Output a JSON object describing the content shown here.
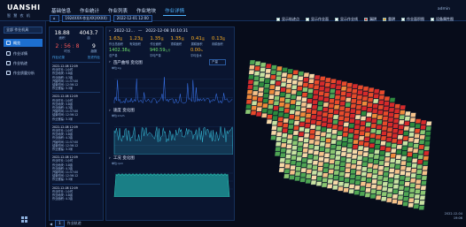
{
  "app": {
    "logo": "UANSHI",
    "logo_sub": "智 慧 农 机"
  },
  "nav": [
    {
      "label": "基础信息",
      "active": false
    },
    {
      "label": "作业统计",
      "active": false
    },
    {
      "label": "作业列表",
      "active": false
    },
    {
      "label": "作业地块",
      "active": false
    },
    {
      "label": "作业详情",
      "active": true
    }
  ],
  "user": {
    "name": "admin"
  },
  "sidebar": {
    "selector": "全部 作业机具",
    "items": [
      {
        "label": "概览",
        "active": true
      },
      {
        "label": "作业详情",
        "active": false
      },
      {
        "label": "作业轨迹",
        "active": false
      },
      {
        "label": "作业质量分析",
        "active": false
      }
    ]
  },
  "toolbar": {
    "device": "1924XXX-作业XX(XXXX)",
    "date": "2022-12-01 12:00"
  },
  "legend": [
    {
      "label": "显示轨迹点",
      "color": "#ffffff"
    },
    {
      "label": "显示作业面",
      "color": "#ffffff"
    },
    {
      "label": "显示作业线",
      "color": "#ffffff"
    },
    {
      "label": "漏耕",
      "color": "#e03a3a"
    },
    {
      "label": "重耕",
      "color": "#f0a020"
    },
    {
      "label": "作业面积图",
      "color": "#ffffff"
    },
    {
      "label": "设备属性图",
      "color": "#ffffff"
    }
  ],
  "left_panel": {
    "stats": [
      {
        "value": "18.88",
        "label": "面积",
        "red": false
      },
      {
        "value": "4043.7",
        "label": "亩",
        "red": false
      }
    ],
    "stats2": [
      {
        "value": "2 : 56 : 8",
        "label": "时长",
        "red": true
      },
      {
        "value": "9",
        "label": "趟数",
        "red": false
      }
    ],
    "tag": "作业记录",
    "tag_right": "历史作业",
    "records": [
      {
        "time": "2022-12-08 12:09",
        "lines": [
          "作业时长: 1小时",
          "作业地块: 3.8亩",
          "作业面积: 4.3亩",
          "开始时间: 11:57:00",
          "结束时间: 12:56:12",
          "作业宽幅: 3.3米"
        ]
      },
      {
        "time": "2022-12-08 12:09",
        "lines": [
          "作业时长: 1小时",
          "作业地块: 3.8亩",
          "作业面积: 4.3亩",
          "开始时间: 11:57:00",
          "结束时间: 12:56:12",
          "作业宽幅: 3.3米"
        ]
      },
      {
        "time": "2022-12-08 12:09",
        "lines": [
          "作业时长: 1小时",
          "作业地块: 3.8亩",
          "作业面积: 4.3亩",
          "开始时间: 11:57:00",
          "结束时间: 12:56:12",
          "作业宽幅: 3.3米"
        ]
      },
      {
        "time": "2022-12-08 12:09",
        "lines": [
          "作业时长: 1小时",
          "作业地块: 3.8亩",
          "作业面积: 4.3亩",
          "开始时间: 11:57:00",
          "结束时间: 12:56:12",
          "作业宽幅: 3.3米"
        ]
      },
      {
        "time": "2022-12-08 12:09",
        "lines": [
          "作业时长: 1小时",
          "作业地块: 3.8亩",
          "作业面积: 4.3亩"
        ]
      }
    ]
  },
  "mid_panel": {
    "range_start": "2022-12...",
    "range_end": "2022-12-08 16:10:31",
    "kpis": [
      {
        "value": "1.63",
        "unit": "亩",
        "label": "作业总面积"
      },
      {
        "value": "1.23",
        "unit": "亩",
        "label": "有效面积"
      },
      {
        "value": "1.35",
        "unit": "亩",
        "label": "作业面积"
      },
      {
        "value": "1.35",
        "unit": "亩",
        "label": "重耕面积"
      },
      {
        "value": "0.41",
        "unit": "亩",
        "label": "漏耕面积"
      },
      {
        "value": "0.13",
        "unit": "亩",
        "label": "未耕面积"
      }
    ],
    "kpis2": [
      {
        "value": "1402.38",
        "unit": "吨",
        "label": "总产量",
        "amber": false
      },
      {
        "value": "940.59",
        "unit": "公斤",
        "label": "平均产量",
        "amber": false
      },
      {
        "value": "0.00",
        "unit": "%",
        "label": "平均含水",
        "amber": true
      }
    ],
    "charts": [
      {
        "title": "亩产曲线 变化图",
        "select": "产量",
        "unit": "单位:kg"
      },
      {
        "title": "速度 变化图",
        "select": "",
        "unit": "单位:km/h"
      },
      {
        "title": "工况 变化图",
        "select": "",
        "unit": "单位:rpm"
      }
    ]
  },
  "footer": {
    "page": "1",
    "label": "作业轨迹"
  },
  "corner": {
    "date": "2022-12-04",
    "time": "19:06"
  }
}
